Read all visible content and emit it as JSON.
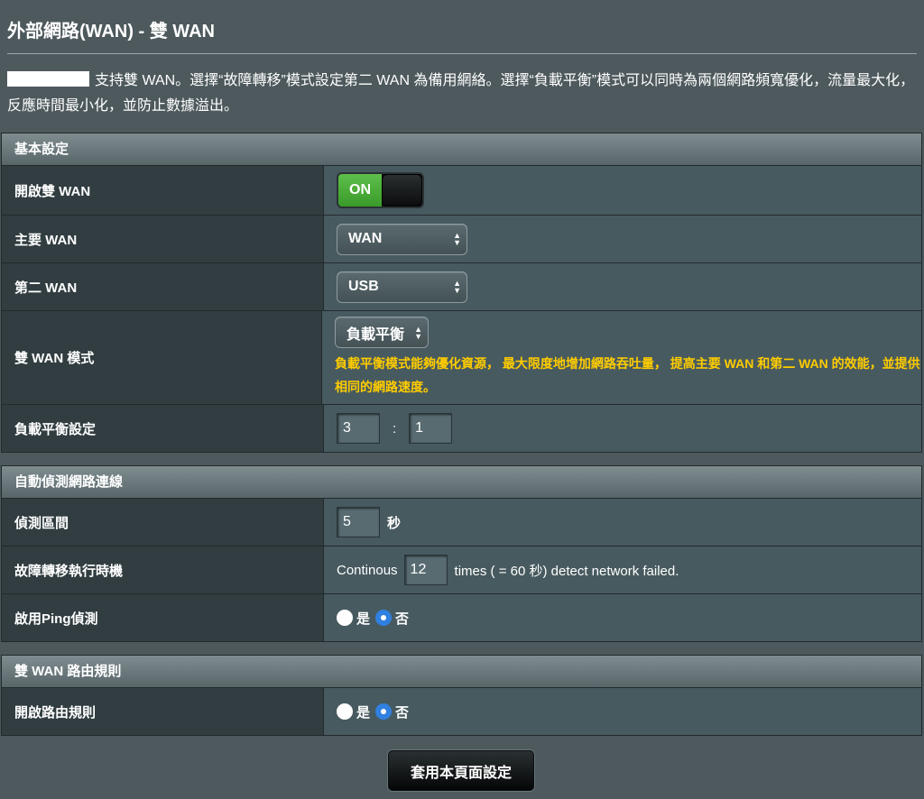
{
  "page": {
    "title": "外部網路(WAN) - 雙 WAN",
    "intro": "支持雙 WAN。選擇“故障轉移”模式設定第二 WAN 為備用網絡。選擇“負載平衡”模式可以同時為兩個網路頻寬優化，流量最大化，反應時間最小化，並防止數據溢出。"
  },
  "basic": {
    "header": "基本設定",
    "enable_dual_wan": {
      "label": "開啟雙 WAN",
      "toggle_text": "ON",
      "state": "on"
    },
    "primary_wan": {
      "label": "主要 WAN",
      "value": "WAN"
    },
    "secondary_wan": {
      "label": "第二 WAN",
      "value": "USB"
    },
    "dual_wan_mode": {
      "label": "雙 WAN 模式",
      "value": "負載平衡",
      "hint": "負載平衡模式能夠優化資源， 最大限度地增加網路吞吐量， 提高主要 WAN 和第二 WAN 的效能，並提供相同的網路速度。"
    },
    "load_balance": {
      "label": "負載平衡設定",
      "left": "3",
      "separator": ":",
      "right": "1"
    }
  },
  "detect": {
    "header": "自動偵測網路連線",
    "interval": {
      "label": "偵測區間",
      "value": "5",
      "unit": "秒"
    },
    "failover": {
      "label": "故障轉移執行時機",
      "prefix": "Continous",
      "value": "12",
      "suffix": "times ( = 60  秒) detect network failed."
    },
    "ping": {
      "label": "啟用Ping偵測",
      "yes": "是",
      "no": "否",
      "selected": "no"
    }
  },
  "routing": {
    "header": "雙 WAN 路由規則",
    "enable": {
      "label": "開啟路由規則",
      "yes": "是",
      "no": "否",
      "selected": "no"
    }
  },
  "apply_button": "套用本頁面設定",
  "colors": {
    "background": "#4d595d",
    "hint": "#ffcc00",
    "toggle_on": "#3a9b2a",
    "radio_selected": "#2f80e0"
  },
  "icons": {
    "select_arrows": "updown-arrows-icon"
  }
}
